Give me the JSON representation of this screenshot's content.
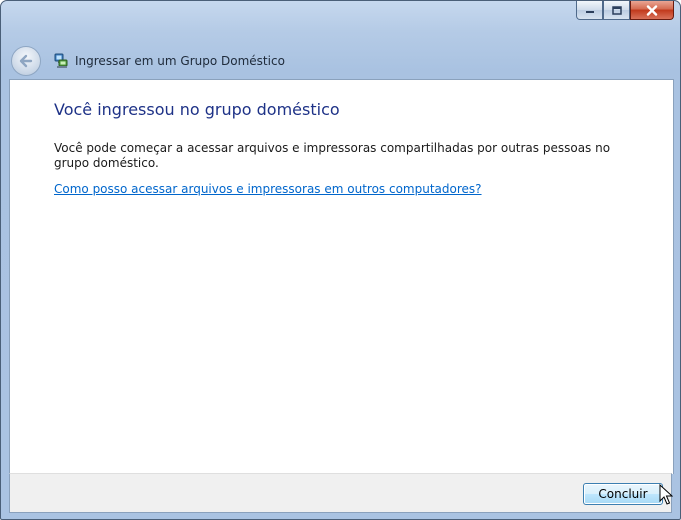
{
  "window": {
    "title": "Ingressar em um Grupo Doméstico",
    "caption_buttons": [
      {
        "name": "minimize-button",
        "icon": "minimize-icon"
      },
      {
        "name": "maximize-button",
        "icon": "maximize-icon"
      },
      {
        "name": "close-button",
        "icon": "close-icon"
      }
    ]
  },
  "nav": {
    "back_icon": "back-arrow-icon",
    "title_icon": "homegroup-icon"
  },
  "main": {
    "heading": "Você ingressou no grupo doméstico",
    "body": "Você pode começar a acessar arquivos e impressoras compartilhadas por outras pessoas no grupo doméstico.",
    "link": "Como posso acessar arquivos e impressoras em outros computadores?"
  },
  "footer": {
    "finish_label": "Concluir"
  },
  "colors": {
    "heading": "#1e3287",
    "link": "#0066cc",
    "close_button": "#c1391c"
  }
}
